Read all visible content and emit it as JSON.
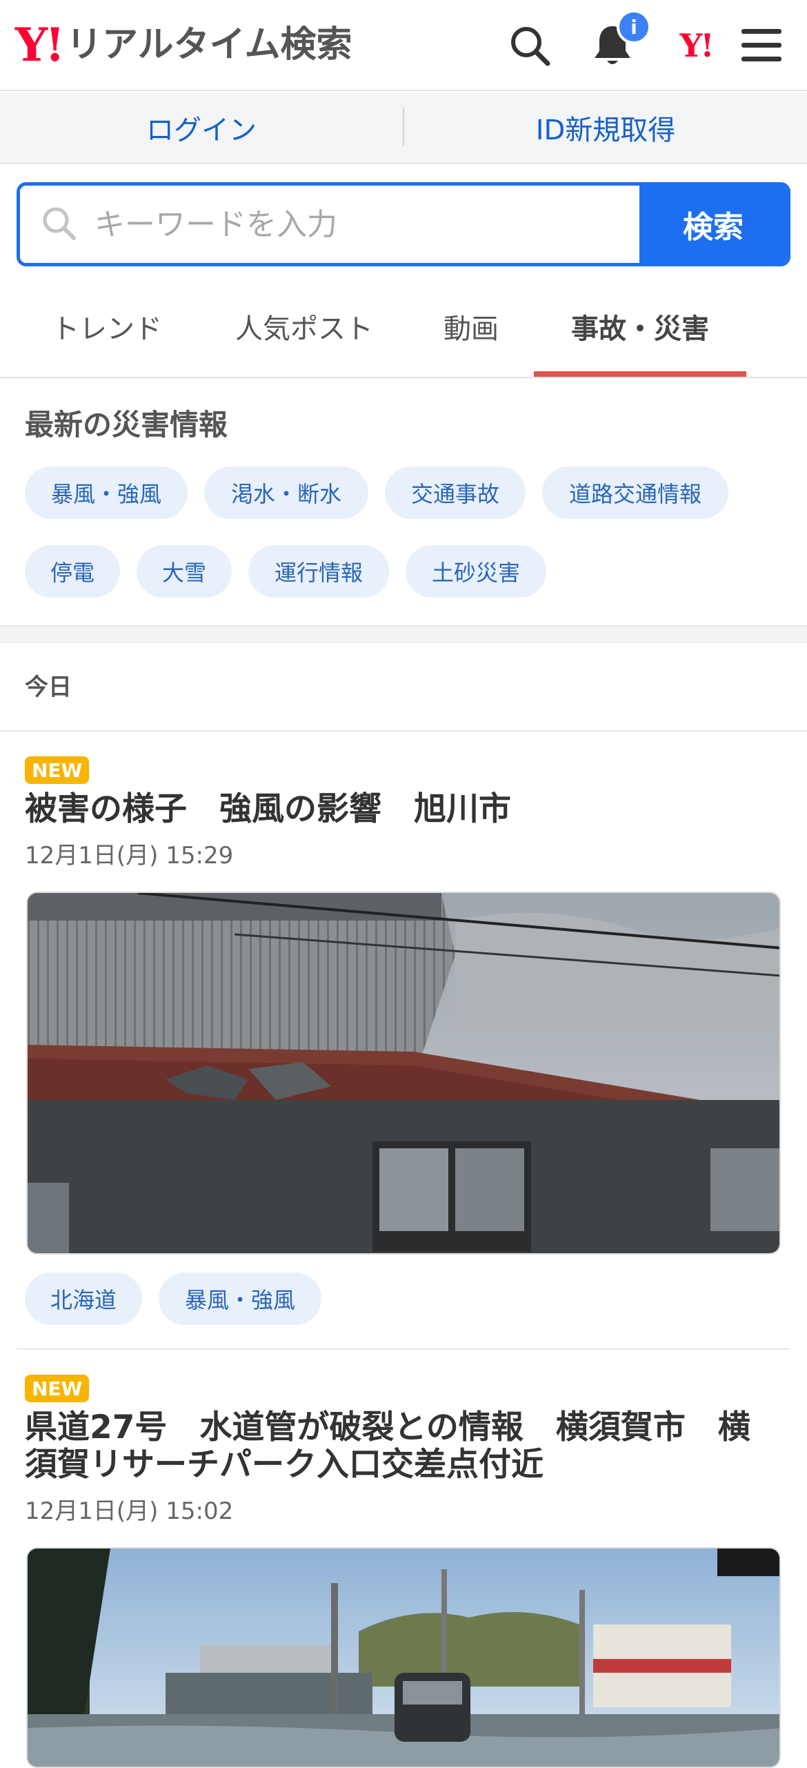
{
  "header": {
    "logo_mark": "Y!",
    "logo_text": "リアルタイム検索",
    "notification_badge": "i",
    "yahoo_mark": "Y!"
  },
  "login_bar": {
    "login": "ログイン",
    "register": "ID新規取得"
  },
  "search": {
    "placeholder": "キーワードを入力",
    "button": "検索"
  },
  "tabs": [
    {
      "label": "トレンド"
    },
    {
      "label": "人気ポスト"
    },
    {
      "label": "動画"
    },
    {
      "label": "事故・災害",
      "active": true
    }
  ],
  "disaster_info": {
    "title": "最新の災害情報",
    "chips": [
      "暴風・強風",
      "渇水・断水",
      "交通事故",
      "道路交通情報",
      "停電",
      "大雪",
      "運行情報",
      "土砂災害"
    ]
  },
  "feed": {
    "section_label": "今日",
    "items": [
      {
        "badge": "NEW",
        "title": "被害の様子　強風の影響　旭川市",
        "date": "12月1日(月) 15:29",
        "image": "damaged-roof-photo",
        "tags": [
          "北海道",
          "暴風・強風"
        ]
      },
      {
        "badge": "NEW",
        "title": "県道27号　水道管が破裂との情報　横須賀市　横須賀リサーチパーク入口交差点付近",
        "date": "12月1日(月) 15:02",
        "image": "flooded-road-photo"
      }
    ]
  },
  "colors": {
    "brand_red": "#ff0033",
    "accent_blue": "#1d6ff0",
    "tab_underline": "#e0524e",
    "new_badge": "#f7b500",
    "chip_bg": "#e8f0fb",
    "chip_text": "#2a66b8"
  }
}
